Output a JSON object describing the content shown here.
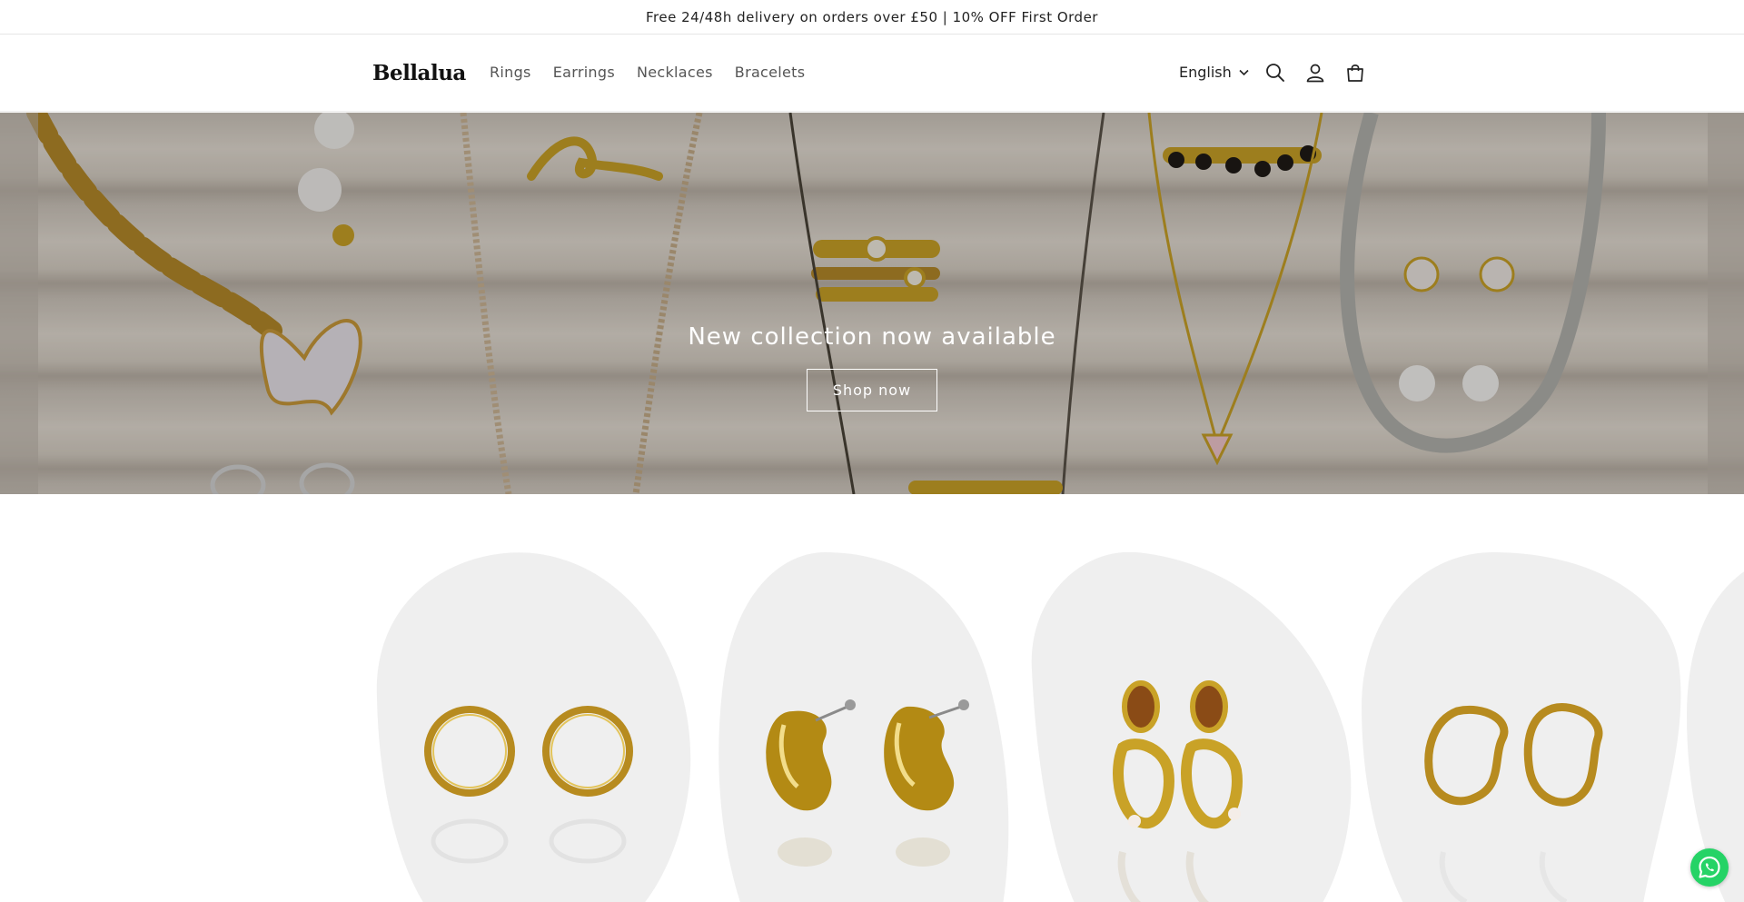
{
  "announcement": {
    "text": "Free 24/48h delivery on orders over £50 | 10% OFF First Order"
  },
  "header": {
    "logo": "Bellalua",
    "nav": [
      {
        "label": "Rings"
      },
      {
        "label": "Earrings"
      },
      {
        "label": "Necklaces"
      },
      {
        "label": "Bracelets"
      }
    ],
    "language": "English",
    "icons": [
      "search-icon",
      "account-icon",
      "cart-icon",
      "chevron-down-icon"
    ]
  },
  "hero": {
    "title": "New collection now available",
    "button_label": "Shop now"
  },
  "products": [
    {
      "image": "gold-hoop-earrings"
    },
    {
      "image": "gold-teardrop-earrings"
    },
    {
      "image": "tiger-eye-drop-earrings"
    },
    {
      "image": "wavy-gold-hoop-earrings"
    }
  ],
  "floating": {
    "whatsapp": "whatsapp-icon"
  },
  "colors": {
    "accent": "#25d366",
    "card_bg": "#efefef",
    "gold": "#c9a227"
  }
}
